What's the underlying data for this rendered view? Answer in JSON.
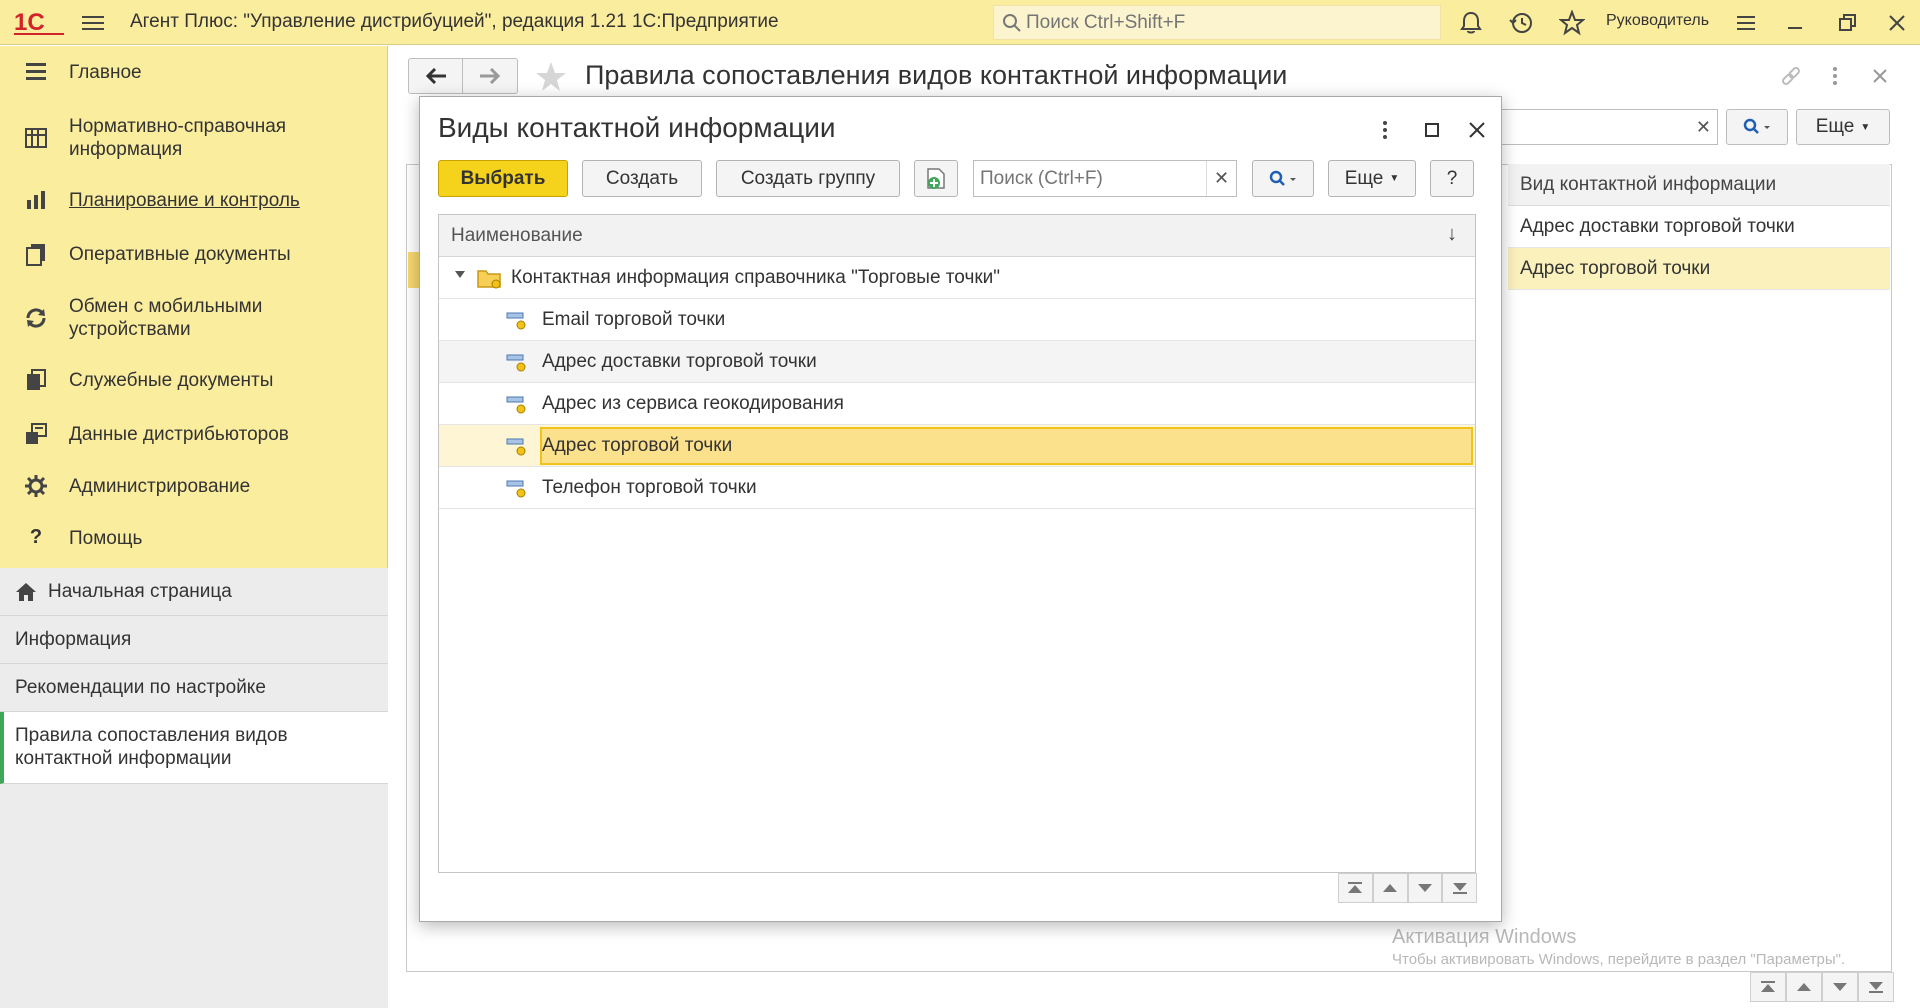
{
  "app": {
    "logo": "1С",
    "title": "Агент Плюс: \"Управление дистрибуцией\", редакция 1.21 1С:Предприятие",
    "search_placeholder": "Поиск Ctrl+Shift+F",
    "user": "Руководитель"
  },
  "sidebar": {
    "sections": [
      {
        "label": "Главное",
        "icon": "list-icon"
      },
      {
        "label": "Нормативно-справочная информация",
        "icon": "catalog-icon"
      },
      {
        "label": "Планирование и контроль",
        "icon": "chart-icon"
      },
      {
        "label": "Оперативные документы",
        "icon": "documents-icon"
      },
      {
        "label": "Обмен с мобильными устройствами",
        "icon": "sync-icon"
      },
      {
        "label": "Служебные документы",
        "icon": "service-docs-icon"
      },
      {
        "label": "Данные дистрибьюторов",
        "icon": "distributor-data-icon"
      },
      {
        "label": "Администрирование",
        "icon": "gear-icon"
      },
      {
        "label": "Помощь",
        "icon": "help-icon"
      }
    ],
    "open_pages": [
      {
        "label": "Начальная страница",
        "icon": "home-icon"
      },
      {
        "label": "Информация"
      },
      {
        "label": "Рекомендации по настройке"
      },
      {
        "label": "Правила сопоставления видов контактной информации",
        "active": true
      }
    ]
  },
  "main": {
    "title": "Правила сопоставления видов контактной информации",
    "more_label": "Еще",
    "column_header": "Вид контактной информации",
    "rows": [
      {
        "label": "Адрес доставки торговой точки"
      },
      {
        "label": "Адрес торговой точки",
        "selected": true
      }
    ]
  },
  "modal": {
    "title": "Виды контактной информации",
    "buttons": {
      "select": "Выбрать",
      "create": "Создать",
      "create_group": "Создать группу",
      "more": "Еще",
      "help": "?"
    },
    "search_placeholder": "Поиск (Ctrl+F)",
    "column_header": "Наименование",
    "sort_indicator": "↓",
    "group": "Контактная информация справочника \"Торговые точки\"",
    "items": [
      {
        "label": "Email торговой точки"
      },
      {
        "label": "Адрес доставки торговой точки"
      },
      {
        "label": "Адрес из сервиса геокодирования"
      },
      {
        "label": "Адрес торговой точки",
        "selected": true
      },
      {
        "label": "Телефон торговой точки"
      }
    ]
  },
  "watermark": {
    "line1": "Активация Windows",
    "line2": "Чтобы активировать Windows, перейдите в раздел \"Параметры\"."
  },
  "colors": {
    "panel_yellow": "#fbed9e",
    "primary_button": "#f5d31c",
    "selection": "#fbe18c",
    "active_marker": "#3ea75a"
  }
}
